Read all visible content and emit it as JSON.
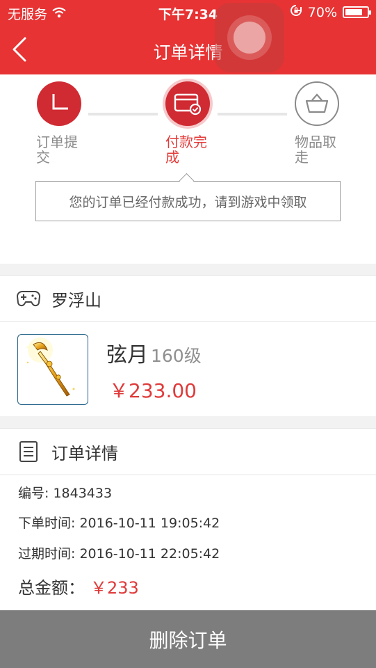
{
  "status_bar": {
    "carrier": "无服务",
    "time": "下午7:34",
    "battery": "70%"
  },
  "nav": {
    "title": "订单详情"
  },
  "progress": {
    "steps": [
      {
        "label": "订单提交",
        "state": "done"
      },
      {
        "label": "付款完成",
        "state": "current"
      },
      {
        "label": "物品取走",
        "state": "todo"
      }
    ],
    "tip": "您的订单已经付款成功，请到游戏中领取"
  },
  "game": {
    "server": "罗浮山",
    "icon": "gamepad-icon"
  },
  "product": {
    "name": "弦月",
    "level": "160级",
    "price": "￥233.00"
  },
  "order_detail": {
    "title": "订单详情",
    "icon": "document-icon",
    "number": "编号: 1843433",
    "order_time": "下单时间: 2016-10-11 19:05:42",
    "expire_time": "过期时间: 2016-10-11 22:05:42",
    "total_label": "总金额：",
    "total_value": "￥233"
  },
  "actions": {
    "delete_label": "删除订单"
  },
  "colors": {
    "brand_red": "#e73334",
    "price_red": "#e03a3a",
    "button_gray": "#7d7d7d"
  }
}
